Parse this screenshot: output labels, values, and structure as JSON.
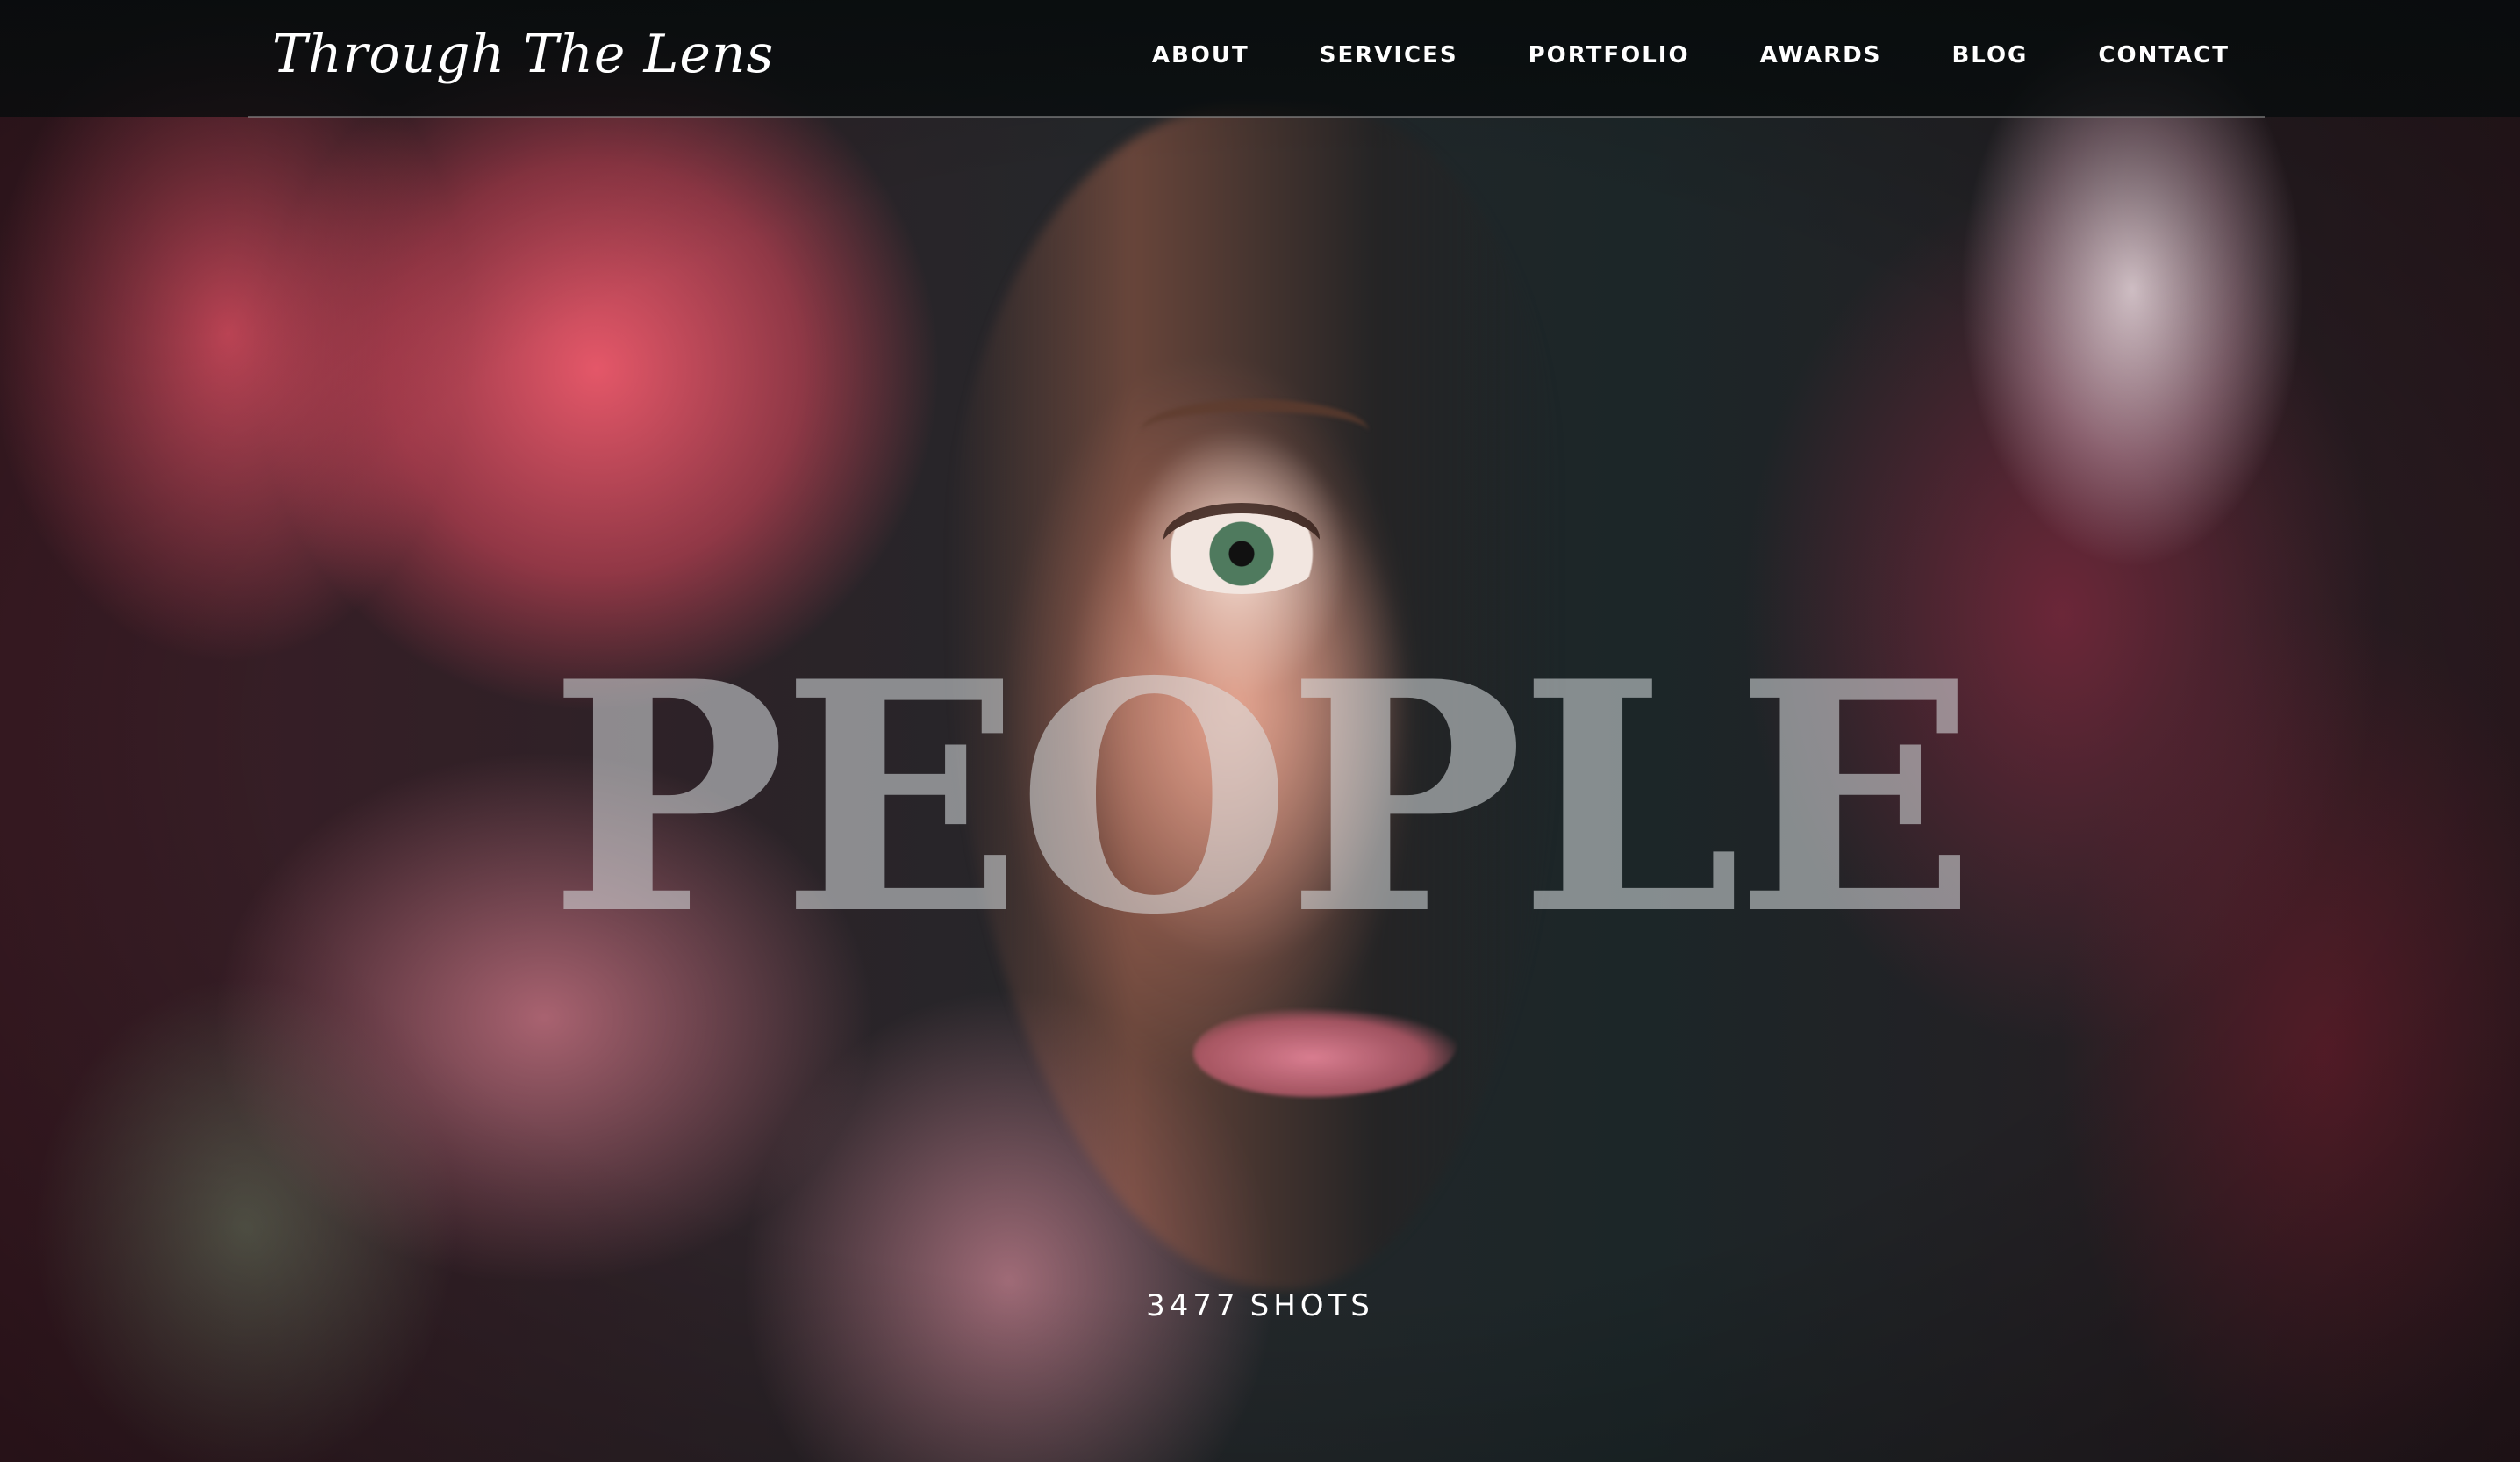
{
  "brand": {
    "name": "Through The Lens"
  },
  "nav": {
    "items": [
      {
        "label": "ABOUT"
      },
      {
        "label": "SERVICES"
      },
      {
        "label": "PORTFOLIO"
      },
      {
        "label": "AWARDS"
      },
      {
        "label": "BLOG"
      },
      {
        "label": "CONTACT"
      }
    ]
  },
  "hero": {
    "title": "PEOPLE",
    "count": "3477",
    "count_unit": "SHOTS"
  },
  "colors": {
    "nav_text": "#ffffff",
    "topbar": "#0b0f10",
    "title_overlay": "#dce1e4"
  }
}
